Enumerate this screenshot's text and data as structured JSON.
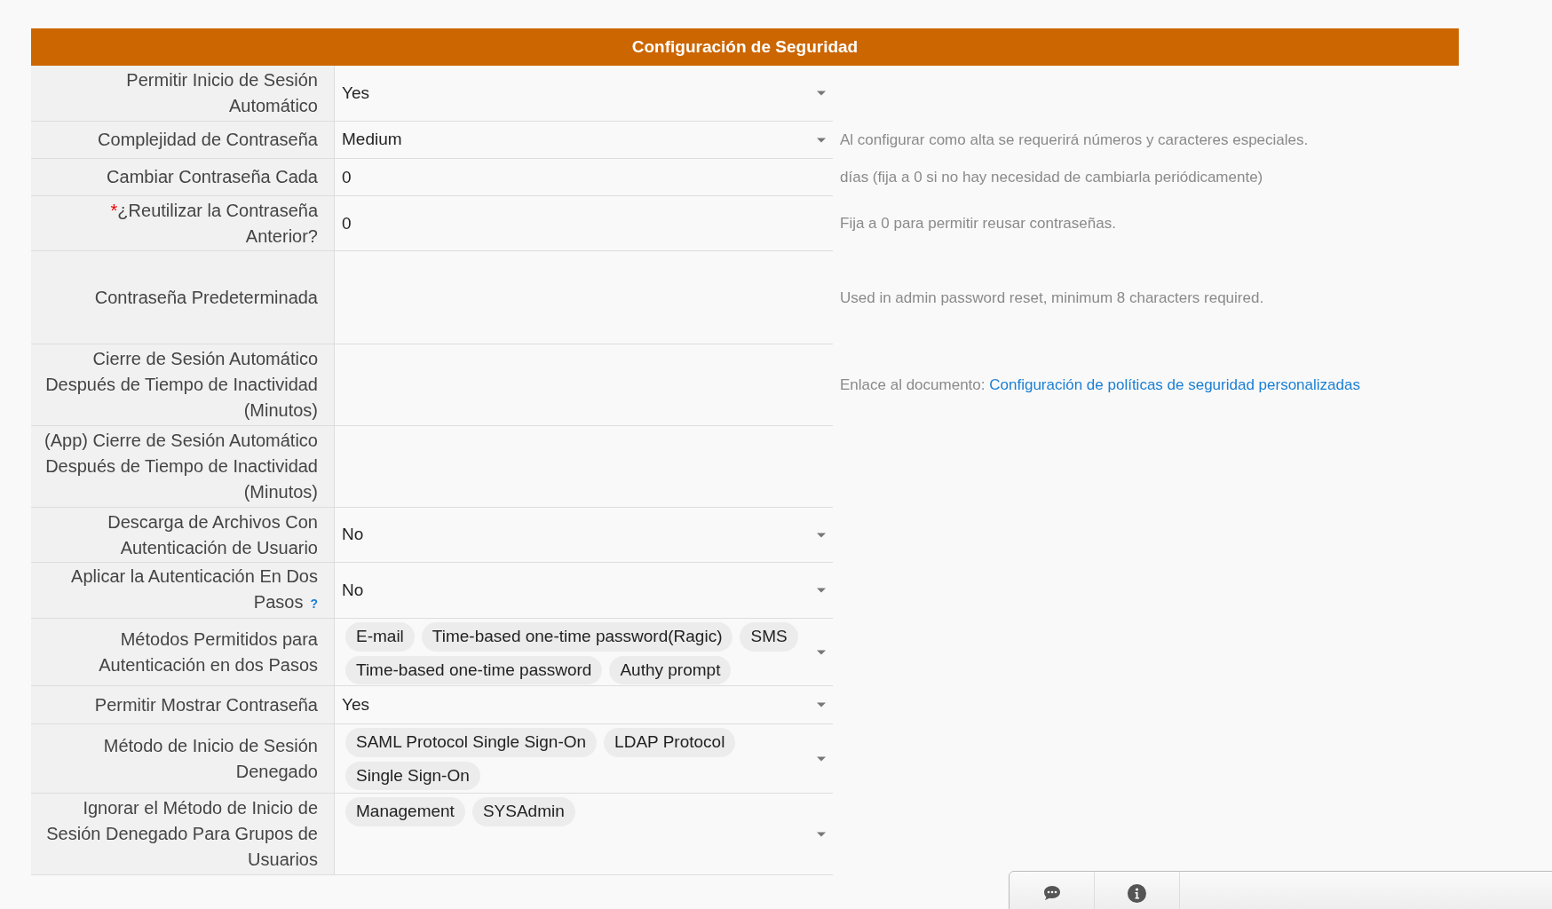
{
  "section_title": "Configuración de Seguridad",
  "rows": [
    {
      "label": "Permitir Inicio de Sesión Automático",
      "kind": "select",
      "value": "Yes"
    },
    {
      "label": "Complejidad de Contraseña",
      "kind": "select",
      "value": "Medium",
      "note": "Al configurar como alta se requerirá números y caracteres especiales."
    },
    {
      "label": "Cambiar Contraseña Cada",
      "kind": "text",
      "value": "0",
      "note": "días (fija a 0 si no hay necesidad de cambiarla periódicamente)"
    },
    {
      "label": "¿Reutilizar la Contraseña Anterior?",
      "kind": "text",
      "value": "0",
      "required": true,
      "required_mark": "*",
      "note": "Fija a 0 para permitir reusar contraseñas."
    },
    {
      "label": "Contraseña Predeterminada",
      "kind": "text",
      "value": "",
      "note": "Used in admin password reset, minimum 8 characters required."
    },
    {
      "label": "Cierre de Sesión Automático Después de Tiempo de Inactividad (Minutos)",
      "kind": "text",
      "value": "",
      "note": "Enlace al documento:",
      "note_link": "Configuración de políticas de seguridad personalizadas"
    },
    {
      "label": "(App) Cierre de Sesión Automático Después de Tiempo de Inactividad (Minutos)",
      "kind": "text",
      "value": ""
    },
    {
      "label": "Descarga de Archivos Con Autenticación de Usuario",
      "kind": "select",
      "value": "No"
    },
    {
      "label": "Aplicar la Autenticación En Dos Pasos",
      "kind": "select",
      "value": "No",
      "help": "?"
    },
    {
      "label": "Métodos Permitidos para Autenticación en dos Pasos",
      "kind": "tags",
      "tags": [
        "E-mail",
        "Time-based one-time password(Ragic)",
        "SMS",
        "Time-based one-time password",
        "Authy prompt"
      ]
    },
    {
      "label": "Permitir Mostrar Contraseña",
      "kind": "select",
      "value": "Yes"
    },
    {
      "label": "Método de Inicio de Sesión Denegado",
      "kind": "tags",
      "tags": [
        "SAML Protocol Single Sign-On",
        "LDAP Protocol",
        "Single Sign-On"
      ]
    },
    {
      "label": "Ignorar el Método de Inicio de Sesión Denegado Para Grupos de Usuarios",
      "kind": "tags",
      "tags": [
        "Management",
        "SYSAdmin"
      ]
    }
  ]
}
